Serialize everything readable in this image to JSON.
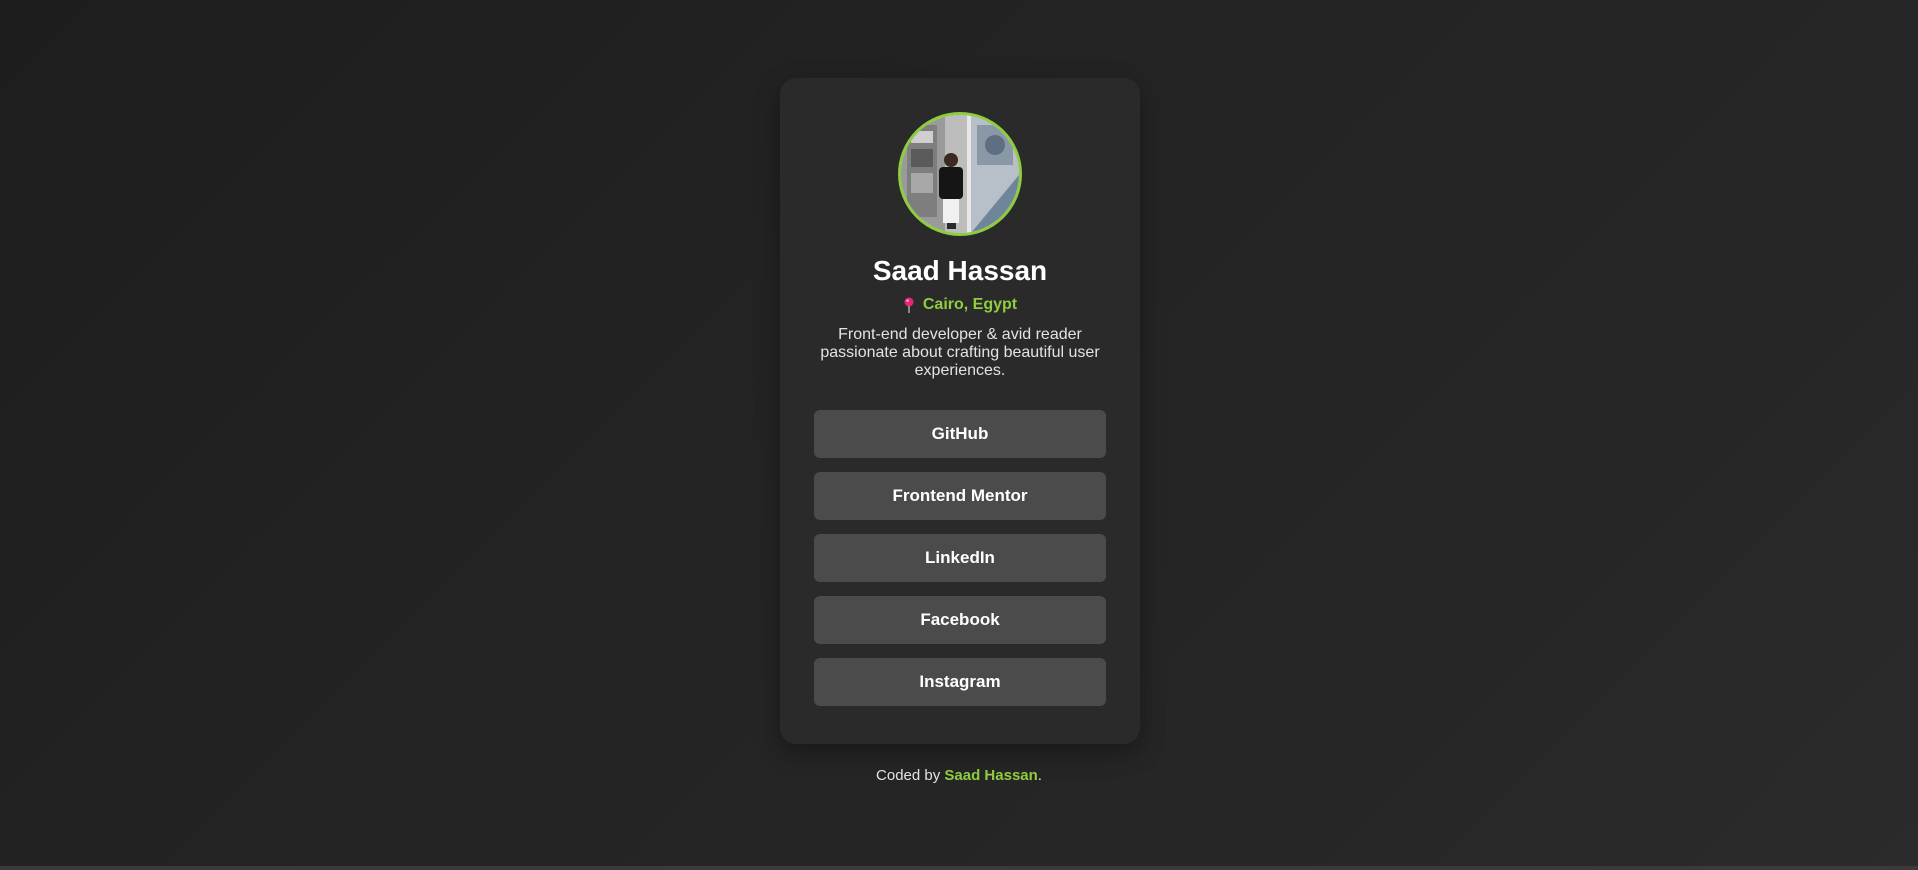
{
  "profile": {
    "name": "Saad Hassan",
    "location": "Cairo, Egypt",
    "bio": "Front-end developer & avid reader passionate about crafting beautiful user experiences.",
    "avatar_icon": "profile-photo",
    "pin_icon": "map-pin-icon"
  },
  "links": [
    {
      "label": "GitHub"
    },
    {
      "label": "Frontend Mentor"
    },
    {
      "label": "LinkedIn"
    },
    {
      "label": "Facebook"
    },
    {
      "label": "Instagram"
    }
  ],
  "footer": {
    "prefix": "Coded by ",
    "author": "Saad Hassan",
    "suffix": "."
  },
  "colors": {
    "accent": "#8fcc3f",
    "card": "#2a2a2a",
    "button": "#4b4b4b",
    "pin": "#e6257a"
  }
}
